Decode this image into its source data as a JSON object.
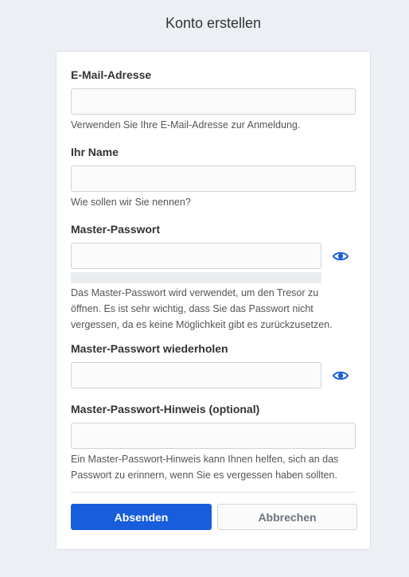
{
  "page": {
    "title": "Konto erstellen"
  },
  "form": {
    "email": {
      "label": "E-Mail-Adresse",
      "value": "",
      "help": "Verwenden Sie Ihre E-Mail-Adresse zur Anmeldung."
    },
    "name": {
      "label": "Ihr Name",
      "value": "",
      "help": "Wie sollen wir Sie nennen?"
    },
    "master_password": {
      "label": "Master-Passwort",
      "value": "",
      "help": "Das Master-Passwort wird verwendet, um den Tresor zu öffnen. Es ist sehr wichtig, dass Sie das Passwort nicht vergessen, da es keine Möglichkeit gibt es zurückzusetzen.",
      "toggle_icon": "eye-icon",
      "strength_fraction": 0
    },
    "master_password_retype": {
      "label": "Master-Passwort wiederholen",
      "value": "",
      "toggle_icon": "eye-icon"
    },
    "hint": {
      "label": "Master-Passwort-Hinweis (optional)",
      "value": "",
      "help": "Ein Master-Passwort-Hinweis kann Ihnen helfen, sich an das Passwort zu erinnern, wenn Sie es vergessen haben sollten."
    }
  },
  "actions": {
    "submit_label": "Absenden",
    "cancel_label": "Abbrechen"
  },
  "colors": {
    "primary": "#175ddc",
    "background": "#eceff4",
    "eye_icon": "#175ddc"
  }
}
